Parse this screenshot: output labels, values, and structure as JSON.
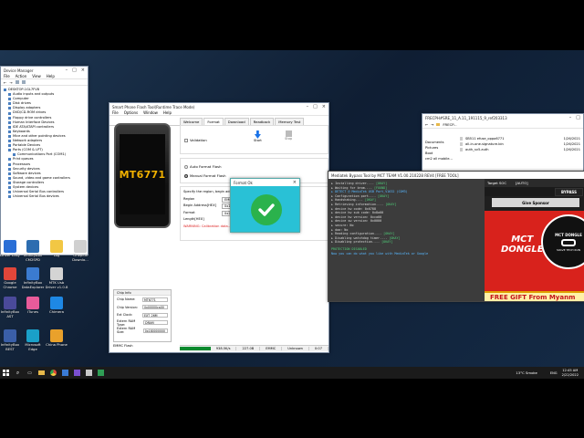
{
  "device_manager": {
    "title": "Device Manager",
    "menu": [
      "File",
      "Action",
      "View",
      "Help"
    ],
    "root": "DESKTOP-1GL7FV8",
    "items": [
      "Audio inputs and outputs",
      "Computer",
      "Disk drives",
      "Display adapters",
      "DVD/CD-ROM drives",
      "Floppy drive controllers",
      "Human Interface Devices",
      "IDE ATA/ATAPI controllers",
      "Keyboards",
      "Mice and other pointing devices",
      "Network adapters",
      "Portable Devices",
      "Ports (COM & LPT)"
    ],
    "port_child": "Communications Port (COM1)",
    "items_after": [
      "Print queues",
      "Processors",
      "Security devices",
      "Software devices",
      "Sound, video and game controllers",
      "Storage controllers",
      "System devices",
      "Universal Serial Bus controllers",
      "Universal Serial Bus devices"
    ]
  },
  "desktop_icons": [
    {
      "label": "Driver Easy",
      "color": "#2a6fd6"
    },
    {
      "label": "InfinityBox CM2SPD",
      "color": "#2d6db0"
    },
    {
      "label": "Log",
      "color": "#f2c744"
    },
    {
      "label": "Oneplus Downlo...",
      "color": "#d0d0d0"
    },
    {
      "label": "Google Chrome",
      "color": "#e0463a"
    },
    {
      "label": "InfinityBox DataExplorer",
      "color": "#3b7bd0"
    },
    {
      "label": "MTK Usb Driver v1.0.8",
      "color": "#d4d4d4"
    },
    {
      "label": "InfinityBox AST",
      "color": "#4a4a9a"
    },
    {
      "label": "iTunes",
      "color": "#e85b9a"
    },
    {
      "label": "Chimera",
      "color": "#1e88e5"
    },
    {
      "label": "InfinityBox BEST",
      "color": "#3a5fa8"
    },
    {
      "label": "Microsoft Edge",
      "color": "#1aa0c8"
    },
    {
      "label": "China Phone",
      "color": "#e9a12b"
    }
  ],
  "flash_tool": {
    "title": "Smart Phone Flash Tool(Runtime Trace Mode)",
    "menu": [
      "File",
      "Options",
      "Window",
      "Help"
    ],
    "tabs": [
      "Welcome",
      "Format",
      "Download",
      "Readback",
      "Memory Test"
    ],
    "model": "MT6771",
    "validation_label": "Validation",
    "start_label": "Start",
    "stop_label": "Stop",
    "auto_format": "Auto Format Flash",
    "manual_format": "Manual Format Flash",
    "specify_text": "Specify the region, begin address...",
    "region_label": "Region",
    "region_value": "EMMC_USER",
    "begin_label": "Begin Address[HEX]",
    "begin_value": "0x18000",
    "length_label": "Format Length[HEX]",
    "length_value": "0x20000",
    "warning": "WARNING: Calibration data...",
    "chip_info_title": "Chip Info",
    "chip_rows": [
      {
        "label": "Chip Name:",
        "value": "MT6771"
      },
      {
        "label": "Chip Version:",
        "value": "0x00000ca00"
      },
      {
        "label": "Ext Clock:",
        "value": "EXT_26M"
      },
      {
        "label": "Extern RAM Type:",
        "value": "DRAM"
      },
      {
        "label": "Extern RAM Size:",
        "value": "0x180000000"
      }
    ],
    "emmc_flash": "EMMC Flash",
    "status": {
      "speed": "938.5K/s",
      "size": "227.0B",
      "storage": "EMMC",
      "port": "Unknown",
      "time": "0:07",
      "progress": 1.0
    }
  },
  "format_ok": {
    "title": "Format Ok"
  },
  "explorer": {
    "title": "FRECPH#SRE_11_A.11_191115_9_ref203313",
    "path": "FRECP...",
    "sidebar": [
      "Documents",
      "Pictures",
      "Boot",
      "cm2 all mobile..."
    ],
    "files": [
      {
        "name": "SB511 efuse_oppo6771",
        "date": "1/26/2021"
      },
      {
        "name": "all-in-one-signature.bin",
        "date": "1/26/2021"
      },
      {
        "name": "auth_sv5.auth",
        "date": "1/26/2021"
      }
    ]
  },
  "bypass_tool": {
    "title": "Mediatek Bypass Tool by MCT TEAM V1.00.210228 REV4 [FREE TOOL]",
    "log": [
      {
        "text": "Installing driver.... ",
        "status": "[OKAY]"
      },
      {
        "text": "Waiting for brom.... ",
        "status": "[FOUND]"
      },
      {
        "text": "DETECT @ MediaTek USB Port_V1632 (COM3)",
        "status": ""
      },
      {
        "text": "Configuration port.... ",
        "status": "[OKAY]"
      },
      {
        "text": "Handshaking.... ",
        "status": "[OKAY]"
      },
      {
        "text": "Retrieving information.... ",
        "status": "[OKAY]"
      },
      {
        "text": "  device hw code: 0x0788",
        "status": ""
      },
      {
        "text": "  device hw sub code: 0x8a00",
        "status": ""
      },
      {
        "text": "  device hw version: 0xca00",
        "status": ""
      },
      {
        "text": "  device sw version: 0x0000",
        "status": ""
      },
      {
        "text": "  secure: No",
        "status": ""
      },
      {
        "text": "  daa: No",
        "status": ""
      },
      {
        "text": "Reading configuration.... ",
        "status": "[OKAY]"
      },
      {
        "text": "Disabling watchdog timer.... ",
        "status": "[OKAY]"
      },
      {
        "text": "Disabling protection.... ",
        "status": "[OKAY]"
      }
    ],
    "protection": "PROTECTION DISABLED",
    "hint": "Now you can do what you like with MediaTek or Google",
    "target_soc_label": "Target SOC",
    "target_soc_value": "[AUTO]",
    "bypass_button": "BYPASS",
    "give_sponsor": "Give Sponsor",
    "banner_line1": "MCT",
    "banner_line2": "DONGLE",
    "badge_text": "MCT DONGLE",
    "badge_sub": "SOLVE TECH RUN",
    "free_gift": "FREE GIFT From Myanm"
  },
  "taskbar": {
    "weather": "13°C Smoke",
    "time": "12:45 AM",
    "date": "2/22/2022",
    "lang": "ENG"
  },
  "colors": {
    "banner_red": "#d8221c",
    "ok_green": "#2bb24c",
    "format_cyan": "#29c1d6",
    "mtk_orange": "#f0b000"
  }
}
